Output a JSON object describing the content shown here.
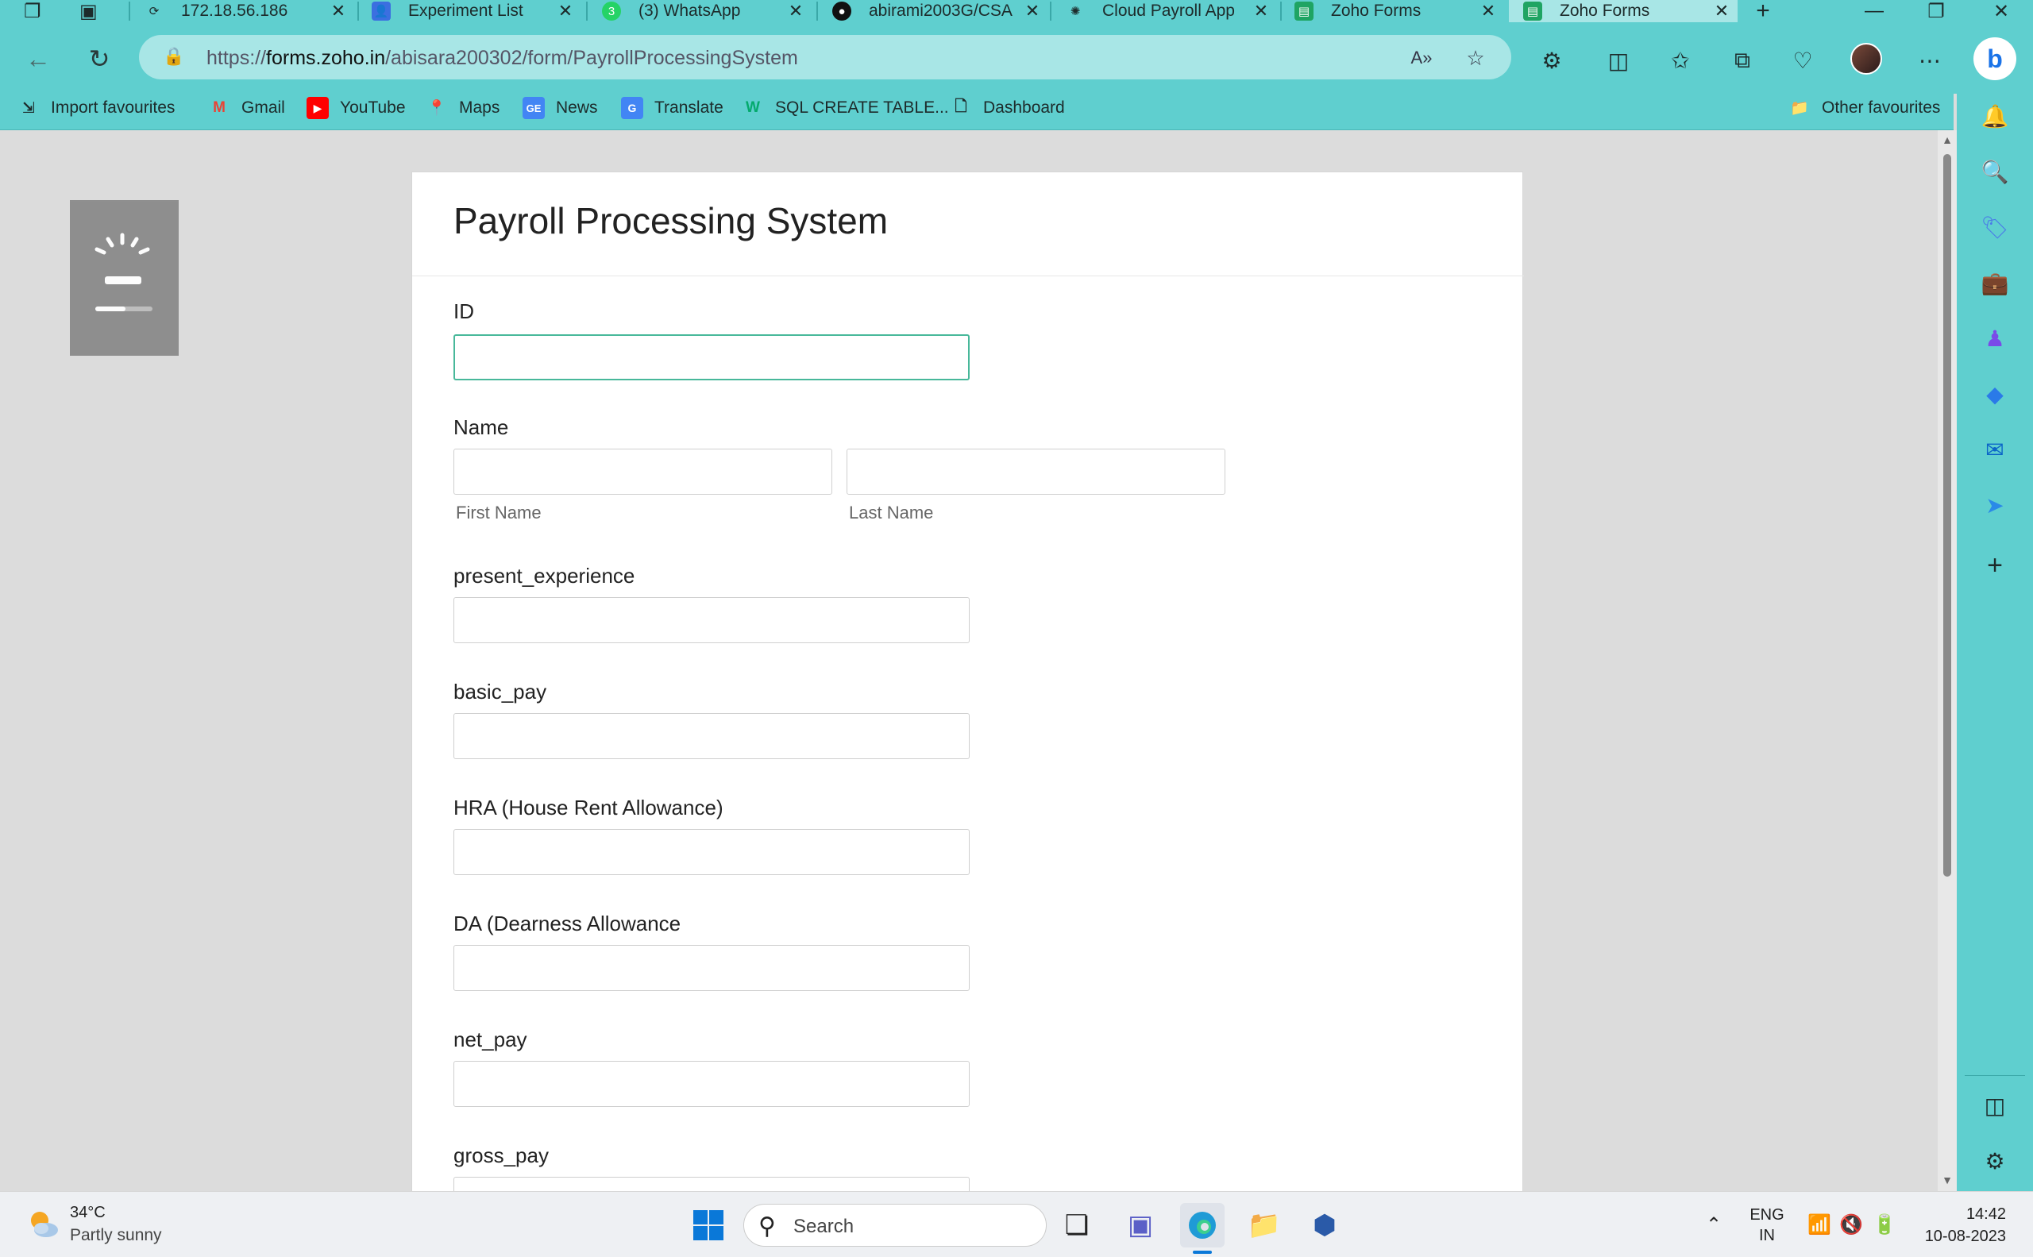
{
  "tabs": [
    {
      "label": "172.18.56.186",
      "icon": "page-icon"
    },
    {
      "label": "Experiment List",
      "icon": "contacts-icon"
    },
    {
      "label": "(3) WhatsApp",
      "icon": "whatsapp-icon"
    },
    {
      "label": "abirami2003G/CSA",
      "icon": "github-icon"
    },
    {
      "label": "Cloud Payroll App",
      "icon": "chatgpt-icon"
    },
    {
      "label": "Zoho Forms",
      "icon": "zoho-forms-icon"
    },
    {
      "label": "Zoho Forms",
      "icon": "zoho-forms-icon",
      "active": true
    }
  ],
  "address": {
    "url_prefix": "https://",
    "url_host": "forms.zoho.in",
    "url_path": "/abisara200302/form/PayrollProcessingSystem"
  },
  "bookmarks": [
    {
      "label": "Import favourites"
    },
    {
      "label": "Gmail"
    },
    {
      "label": "YouTube"
    },
    {
      "label": "Maps"
    },
    {
      "label": "News"
    },
    {
      "label": "Translate"
    },
    {
      "label": "SQL CREATE TABLE..."
    },
    {
      "label": "Dashboard"
    },
    {
      "label": "Other favourites"
    }
  ],
  "form": {
    "title": "Payroll Processing System",
    "fields": {
      "id": "ID",
      "name": "Name",
      "first_name": "First Name",
      "last_name": "Last Name",
      "present_experience": "present_experience",
      "basic_pay": "basic_pay",
      "hra": "HRA (House Rent Allowance)",
      "da": "DA (Dearness Allowance",
      "net_pay": "net_pay",
      "gross_pay": "gross_pay"
    }
  },
  "taskbar": {
    "weather_temp": "34°C",
    "weather_desc": "Partly sunny",
    "search_placeholder": "Search",
    "lang_top": "ENG",
    "lang_bottom": "IN",
    "time": "14:42",
    "date": "10-08-2023"
  },
  "colors": {
    "browser_chrome": "#5fcfcf",
    "active_tab": "#a8e6e6",
    "focus_border": "#48b89a"
  }
}
